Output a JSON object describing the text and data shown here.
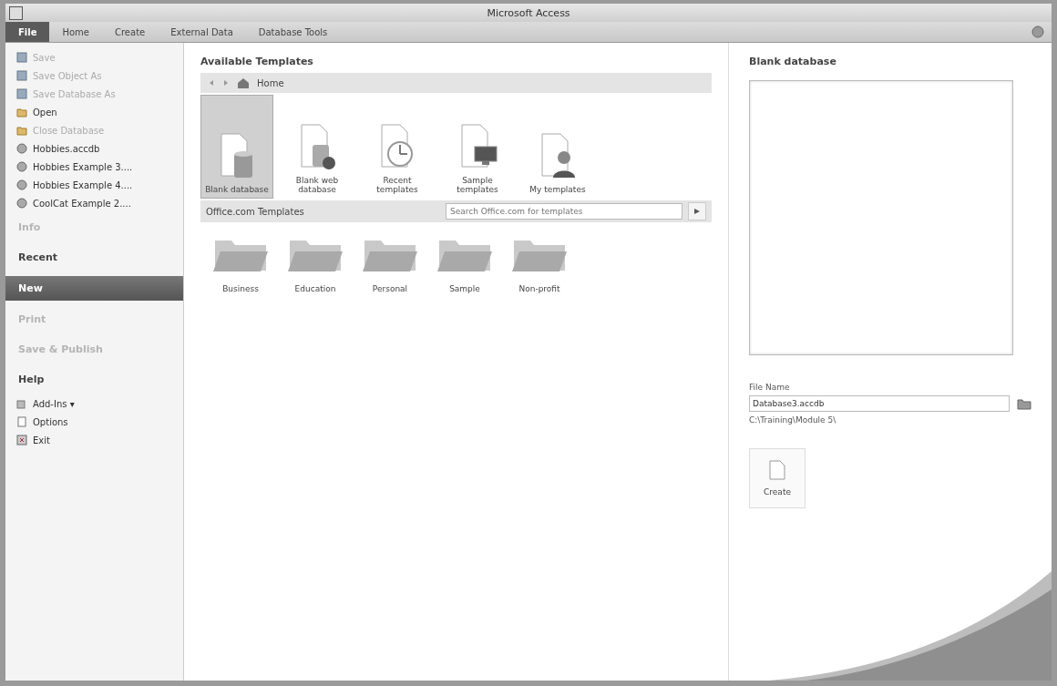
{
  "window": {
    "title": "Microsoft Access"
  },
  "ribbon_tabs": [
    {
      "label": "File",
      "selected": true
    },
    {
      "label": "Home",
      "selected": false
    },
    {
      "label": "Create",
      "selected": false
    },
    {
      "label": "External Data",
      "selected": false
    },
    {
      "label": "Database Tools",
      "selected": false
    }
  ],
  "sidebar": {
    "items": [
      {
        "kind": "save",
        "label": "Save",
        "disabled": true
      },
      {
        "kind": "save",
        "label": "Save Object As",
        "disabled": true
      },
      {
        "kind": "save",
        "label": "Save Database As",
        "disabled": true
      },
      {
        "kind": "open",
        "label": "Open",
        "disabled": false
      },
      {
        "kind": "open",
        "label": "Close Database",
        "disabled": true
      },
      {
        "kind": "file",
        "label": "Hobbies.accdb",
        "disabled": false
      },
      {
        "kind": "file",
        "label": "Hobbies Example 3....",
        "disabled": false
      },
      {
        "kind": "file",
        "label": "Hobbies Example 4....",
        "disabled": false
      },
      {
        "kind": "file",
        "label": "CoolCat Example 2....",
        "disabled": false
      },
      {
        "kind": "section",
        "label": "Info",
        "disabled": true,
        "selected": false
      },
      {
        "kind": "section",
        "label": "Recent",
        "disabled": false,
        "selected": false
      },
      {
        "kind": "section",
        "label": "New",
        "disabled": false,
        "selected": true
      },
      {
        "kind": "section",
        "label": "Print",
        "disabled": true,
        "selected": false
      },
      {
        "kind": "section",
        "label": "Save & Publish",
        "disabled": true,
        "selected": false
      },
      {
        "kind": "section",
        "label": "Help",
        "disabled": false,
        "selected": false
      },
      {
        "kind": "addin",
        "label": "Add-Ins ▾",
        "disabled": false
      },
      {
        "kind": "options",
        "label": "Options",
        "disabled": false
      },
      {
        "kind": "exit",
        "label": "Exit",
        "disabled": false
      }
    ]
  },
  "templates": {
    "title": "Available Templates",
    "nav_label": "Home",
    "items": [
      {
        "kind": "blank",
        "label": "Blank database",
        "selected": true
      },
      {
        "kind": "web",
        "label": "Blank web database",
        "selected": false
      },
      {
        "kind": "recent",
        "label": "Recent templates",
        "selected": false
      },
      {
        "kind": "sample",
        "label": "Sample templates",
        "selected": false
      },
      {
        "kind": "mine",
        "label": "My templates",
        "selected": false
      }
    ],
    "office_title": "Office.com Templates",
    "search": {
      "placeholder": "Search Office.com for templates"
    },
    "folders": [
      "Business",
      "Education",
      "Personal",
      "Sample",
      "Non-profit"
    ]
  },
  "details": {
    "title": "Blank database",
    "file_name_label": "File Name",
    "file_name": "Database3.accdb",
    "path": "C:\\Training\\Module 5\\",
    "create_button": "Create"
  }
}
